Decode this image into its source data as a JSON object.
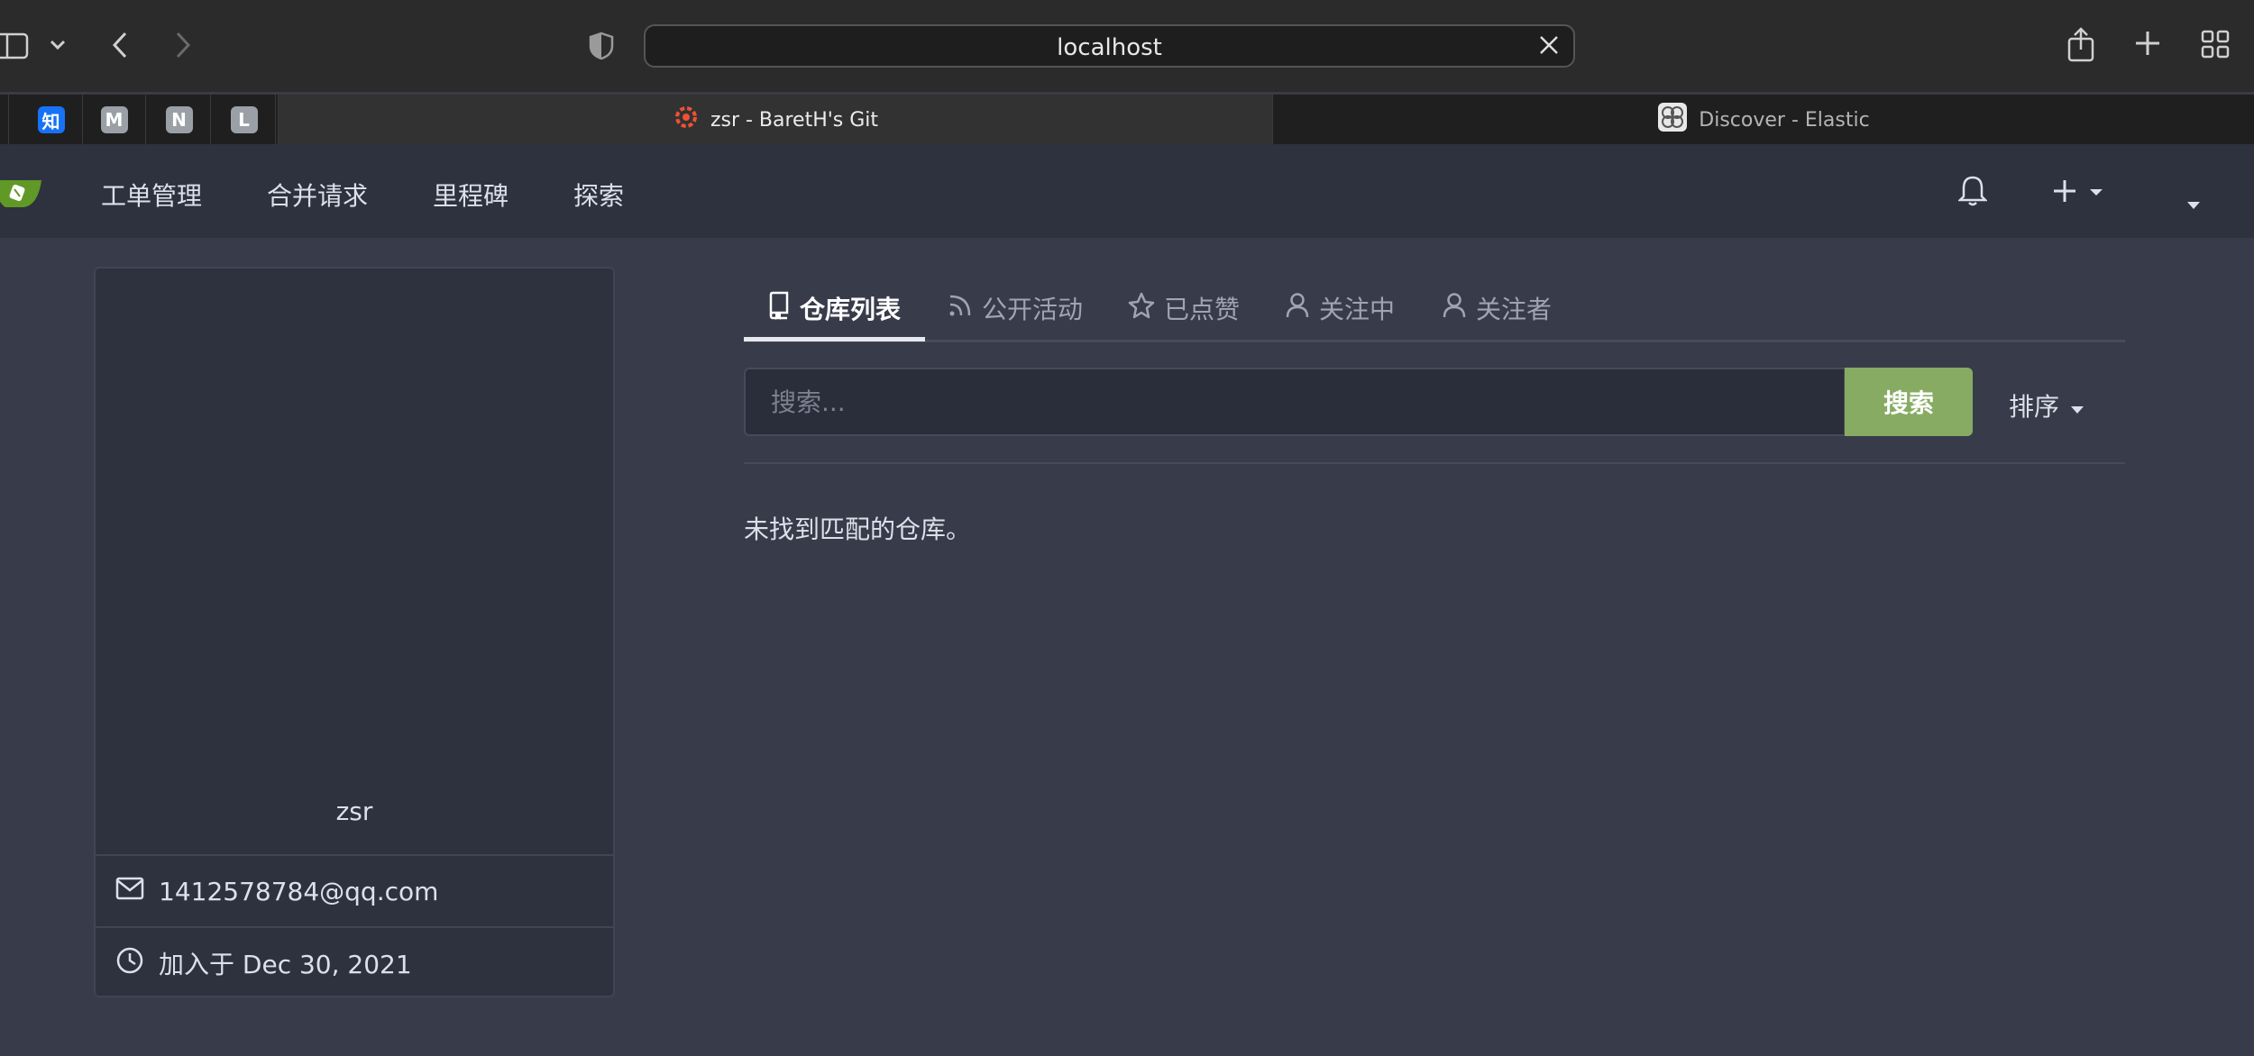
{
  "browser": {
    "url": "localhost",
    "pinned_tabs": [
      {
        "label": "知",
        "icon": "zhihu-icon",
        "color": "#1772f6"
      },
      {
        "label": "M",
        "icon": "m-icon",
        "color": "#9aa0a6"
      },
      {
        "label": "N",
        "icon": "n-icon",
        "color": "#9aa0a6"
      },
      {
        "label": "L",
        "icon": "l-icon",
        "color": "#9aa0a6"
      }
    ],
    "tabs": [
      {
        "title": "zsr - BaretH's Git",
        "icon": "gitea-gear-icon",
        "active": true
      },
      {
        "title": "Discover - Elastic",
        "icon": "elastic-icon",
        "active": false
      }
    ]
  },
  "nav": {
    "items": [
      "工单管理",
      "合并请求",
      "里程碑",
      "探索"
    ]
  },
  "profile": {
    "username": "zsr",
    "email": "1412578784@qq.com",
    "joined": "加入于 Dec 30, 2021"
  },
  "user_tabs": [
    {
      "label": "仓库列表",
      "icon": "repo-icon",
      "active": true
    },
    {
      "label": "公开活动",
      "icon": "rss-icon",
      "active": false
    },
    {
      "label": "已点赞",
      "icon": "star-icon",
      "active": false
    },
    {
      "label": "关注中",
      "icon": "person-icon",
      "active": false
    },
    {
      "label": "关注者",
      "icon": "person-icon",
      "active": false
    }
  ],
  "search": {
    "placeholder": "搜索...",
    "button": "搜索",
    "sort": "排序"
  },
  "empty_message": "未找到匹配的仓库。",
  "colors": {
    "accent_green": "#87ab63",
    "page_bg": "#383c4a",
    "navbar_bg": "#2e323e"
  }
}
